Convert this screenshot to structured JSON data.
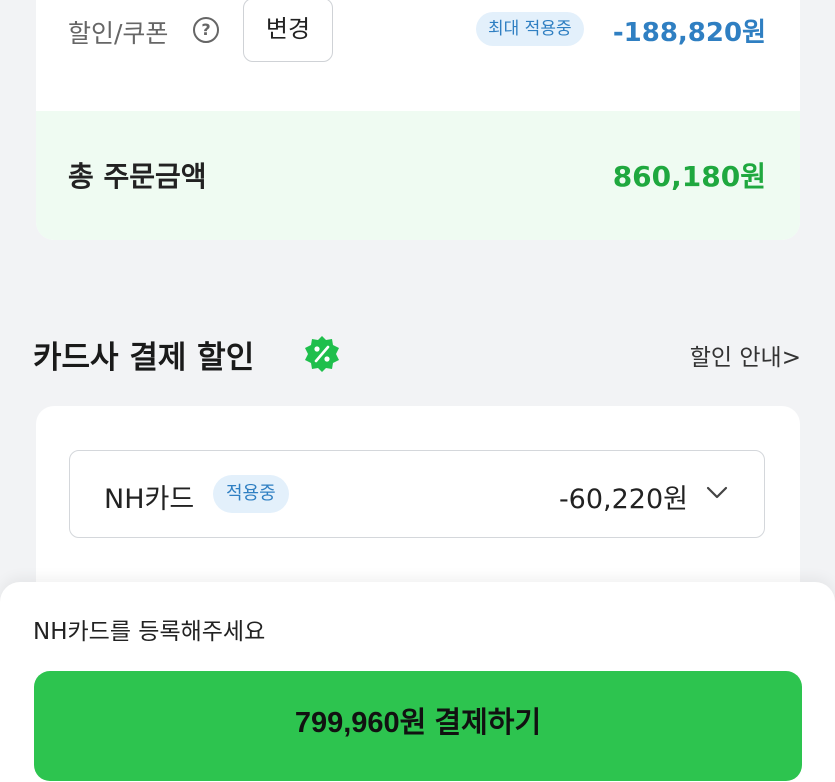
{
  "coupon": {
    "label": "할인/쿠폰",
    "help_symbol": "?",
    "change_label": "변경",
    "max_badge": "최대 적용중",
    "amount": "-188,820원"
  },
  "total": {
    "label": "총 주문금액",
    "amount": "860,180원"
  },
  "card_discount_section": {
    "title": "카드사 결제 할인",
    "info_link": "할인 안내>",
    "icon": "percent-badge-icon",
    "card": {
      "name": "NH카드",
      "badge": "적용중",
      "discount": "-60,220원",
      "icon": "chevron-down-icon"
    }
  },
  "bottom": {
    "register_message": "NH카드를 등록해주세요",
    "pay_button_label": "799,960원 결제하기"
  },
  "colors": {
    "accent_green": "#2dc44f",
    "total_green": "#1fa83f",
    "discount_blue": "#2f7fc2",
    "background": "#f2f3f5"
  }
}
